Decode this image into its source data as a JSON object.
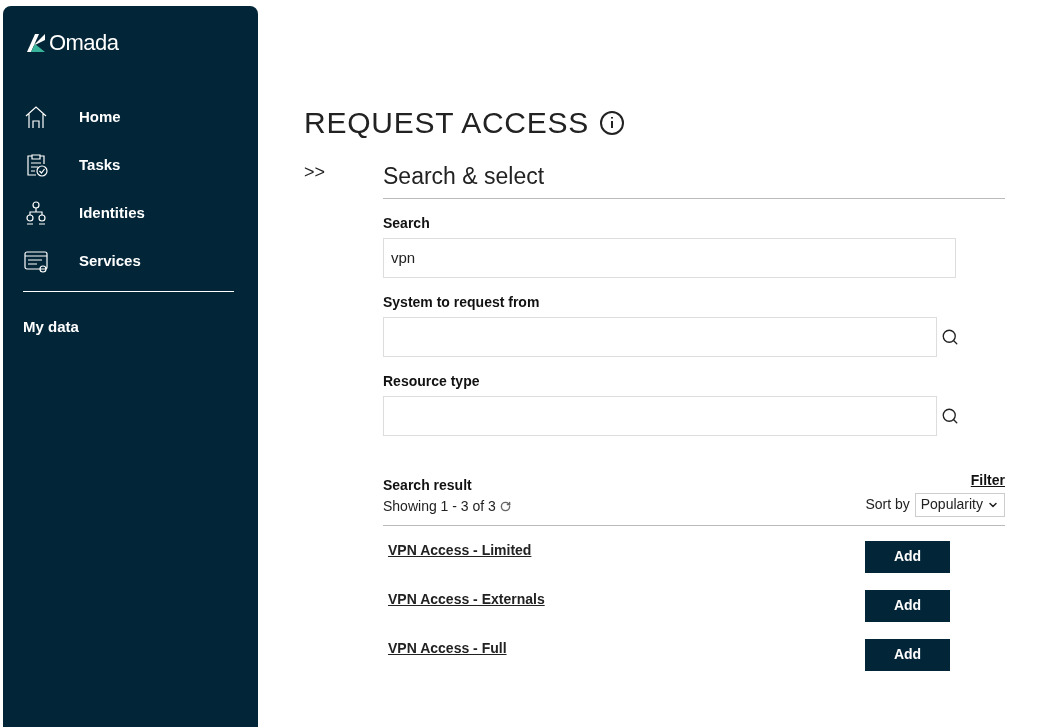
{
  "sidebar": {
    "logo": "Omada",
    "items": [
      {
        "label": "Home"
      },
      {
        "label": "Tasks"
      },
      {
        "label": "Identities"
      },
      {
        "label": "Services"
      }
    ],
    "footer_items": [
      "My data"
    ]
  },
  "page": {
    "title": "REQUEST ACCESS",
    "toggle": ">>",
    "section": "Search & select"
  },
  "fields": [
    {
      "label": "Search",
      "kind": "text",
      "value": "vpn"
    },
    {
      "label": "System to request from",
      "kind": "lookup"
    },
    {
      "label": "Resource type",
      "kind": "lookup"
    }
  ],
  "results": {
    "title": "Search result",
    "showing": "Showing 1 - 3 of 3",
    "filter": "Filter",
    "sort_label": "Sort by",
    "sort_value": "Popularity",
    "items": [
      {
        "name": "VPN Access - Limited",
        "button": "Add"
      },
      {
        "name": "VPN Access - Externals",
        "button": "Add"
      },
      {
        "name": "VPN Access - Full",
        "button": "Add"
      }
    ]
  }
}
